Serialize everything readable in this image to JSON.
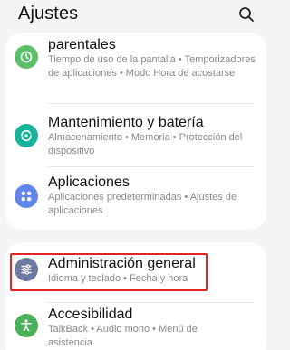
{
  "header": {
    "title": "Ajustes",
    "search_icon": "search-icon"
  },
  "colors": {
    "background": "#f5f5f7",
    "card": "#ffffff",
    "highlight": "#e02424",
    "parental_icon": "#5cbf6a",
    "maintenance_icon": "#19b39a",
    "apps_icon": "#5f86e8",
    "general_icon": "#6c7aa3",
    "accessibility_icon": "#4caf5a"
  },
  "items": [
    {
      "title": "parentales",
      "subtitle": "Tiempo de uso de la pantalla • Temporizadores de aplicaciones • Modo Hora de acostarse",
      "icon": "parental-controls-icon"
    },
    {
      "title": "Mantenimiento y batería",
      "subtitle": "Almacenamiento • Memoria • Protección del dispositivo",
      "icon": "device-care-icon"
    },
    {
      "title": "Aplicaciones",
      "subtitle": "Aplicaciones predeterminadas • Ajustes de aplicaciones",
      "icon": "apps-grid-icon"
    },
    {
      "title": "Administración general",
      "subtitle": "Idioma y teclado • Fecha y hora",
      "icon": "sliders-icon"
    },
    {
      "title": "Accesibilidad",
      "subtitle": "TalkBack • Audio mono • Menú de asistencia",
      "icon": "accessibility-icon"
    }
  ]
}
